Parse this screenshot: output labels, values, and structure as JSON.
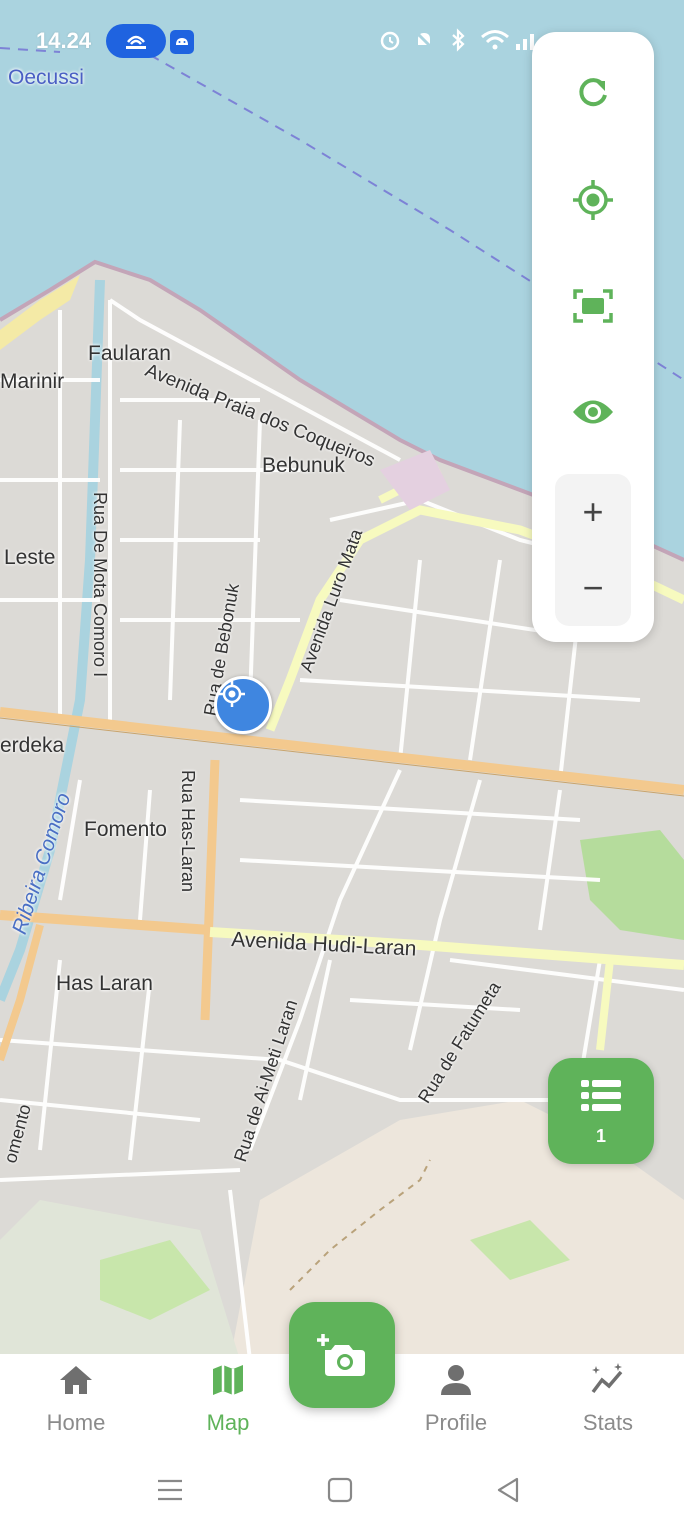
{
  "status": {
    "time": "14.24"
  },
  "map": {
    "labels": {
      "oecussi": "Oecussi",
      "faularan": "Faularan",
      "marinir": "Marinir",
      "avenida_praia": "Avenida Praia dos Coqueiros",
      "bebunuk": "Bebunuk",
      "leste": "Leste",
      "rua_mota": "Rua De Mota Comoro I",
      "rua_bebonuk": "Rua de Bebonuk",
      "avenida_luro": "Avenida Luro Mata",
      "merdeka": "erdeka",
      "fomento": "Fomento",
      "ribeira": "Ribeira Comoro",
      "rua_has": "Rua Has-Laran",
      "avenida_hudi": "Avenida Hudi-Laran",
      "has_laran": "Has Laran",
      "rua_meti": "Rua de Ai-Meti Laran",
      "rua_fatumeta": "Rua de Fatumeta",
      "omento": "omento"
    }
  },
  "controls": {
    "refresh_icon": "refresh-icon",
    "locate_icon": "my-location-icon",
    "fit_icon": "fit-screen-icon",
    "visibility_icon": "eye-icon",
    "zoom_in": "+",
    "zoom_out": "−"
  },
  "list_button": {
    "count": "1",
    "icon": "list-icon"
  },
  "camera_button": {
    "icon": "add-photo-icon"
  },
  "nav": {
    "items": [
      {
        "label": "Home",
        "icon": "home-icon"
      },
      {
        "label": "Map",
        "icon": "map-icon",
        "active": true
      },
      {
        "label": "Profile",
        "icon": "person-icon"
      },
      {
        "label": "Stats",
        "icon": "stats-icon"
      }
    ]
  },
  "colors": {
    "accent": "#5fb35a",
    "sea": "#aad3df",
    "marker": "#3f86e0"
  }
}
